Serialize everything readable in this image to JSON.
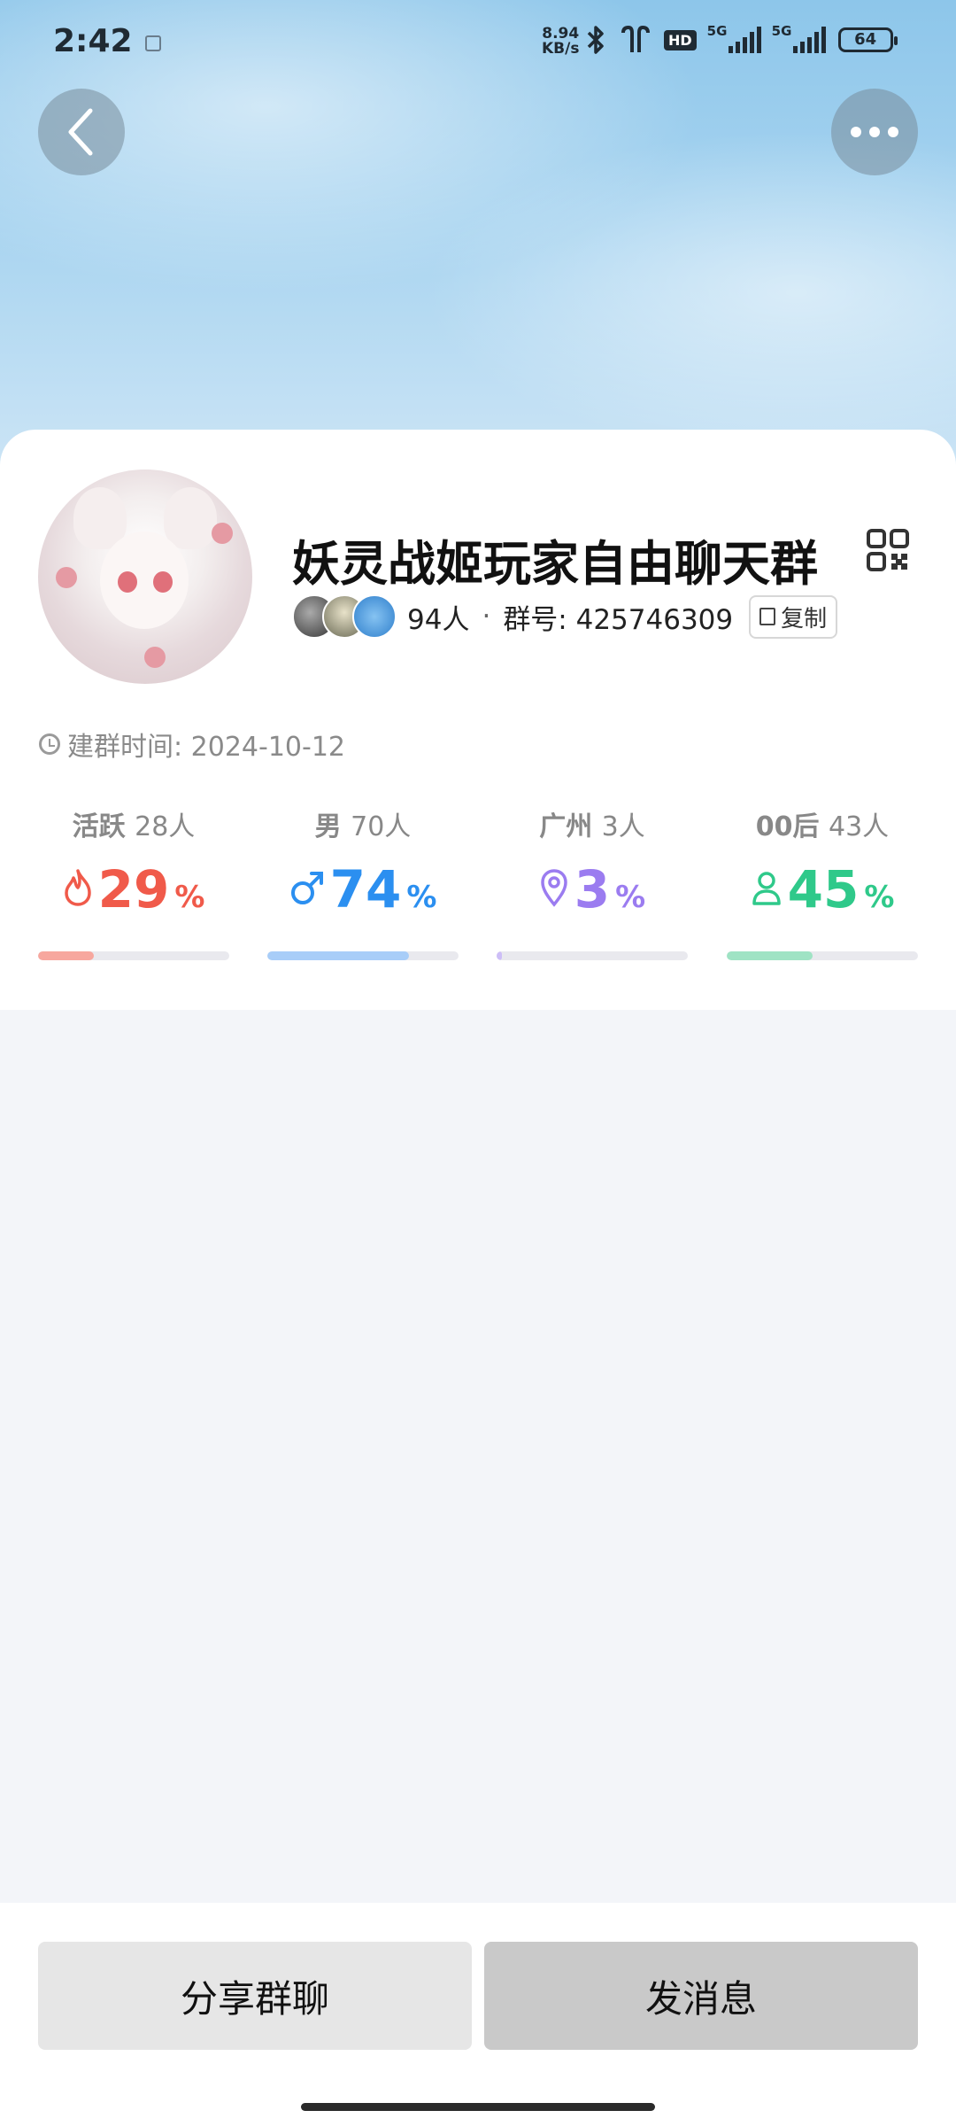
{
  "status_bar": {
    "time": "2:42",
    "net_speed_value": "8.94",
    "net_speed_unit": "KB/s",
    "hd_label": "HD",
    "signal1_label": "5G",
    "signal2_label": "5G",
    "battery": "64"
  },
  "group": {
    "name": "妖灵战姬玩家自由聊天群",
    "member_count": "94人",
    "separator": "·",
    "group_number": "群号: 425746309",
    "copy_label": "复制",
    "created": "建群时间: 2024-10-12"
  },
  "stats": [
    {
      "label": "活跃",
      "count": "28人",
      "value": "29",
      "unit": "%",
      "icon": "flame-icon",
      "color": "#f05a4a",
      "bar_color": "#f7a79e",
      "progress": 0.29
    },
    {
      "label": "男",
      "count": "70人",
      "value": "74",
      "unit": "%",
      "icon": "male-icon",
      "color": "#2b8ff0",
      "bar_color": "#a8cdf8",
      "progress": 0.74
    },
    {
      "label": "广州",
      "count": "3人",
      "value": "3",
      "unit": "%",
      "icon": "location-pin-icon",
      "color": "#9b7cf0",
      "bar_color": "#cdbef7",
      "progress": 0.03
    },
    {
      "label": "00后",
      "count": "43人",
      "value": "45",
      "unit": "%",
      "icon": "person-icon",
      "color": "#2fc98a",
      "bar_color": "#9fe3c4",
      "progress": 0.45
    }
  ],
  "actions": {
    "share_label": "分享群聊",
    "message_label": "发消息"
  }
}
